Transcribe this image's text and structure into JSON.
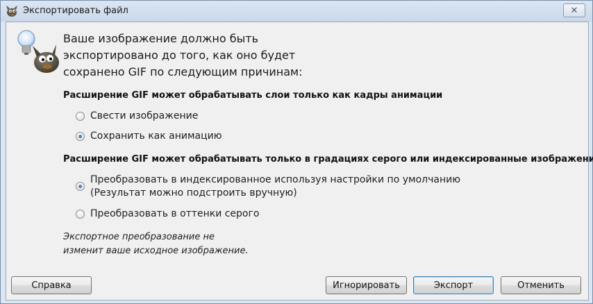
{
  "window": {
    "title": "Экспортировать файл",
    "close_glyph": "✕"
  },
  "icons": {
    "app": "gimp-wilber-icon",
    "hint": "wilber-lightbulb-icon"
  },
  "intro": {
    "line1": "Ваше изображение должно быть",
    "line2": "экспортировано до того, как оно будет",
    "line3": "сохранено GIF по следующим причинам:"
  },
  "section_layers": {
    "heading": "Расширение GIF может обрабатывать слои только как кадры анимации",
    "options": [
      {
        "label": "Свести изображение",
        "checked": false
      },
      {
        "label": "Сохранить как анимацию",
        "checked": true
      }
    ]
  },
  "section_color": {
    "heading": "Расширение GIF может обрабатывать только в градациях серого или индексированные изображения",
    "options": [
      {
        "line1": "Преобразовать в индексированное используя настройки по умолчанию",
        "line2": "(Результат можно подстроить вручную)",
        "checked": true
      },
      {
        "line1": "Преобразовать в оттенки серого",
        "checked": false
      }
    ]
  },
  "note": {
    "line1": "Экспортное преобразование не",
    "line2": "изменит ваше исходное изображение."
  },
  "buttons": {
    "help": "Справка",
    "ignore": "Игнорировать",
    "export": "Экспорт",
    "cancel": "Отменить"
  },
  "colors": {
    "accent": "#3c7fb1",
    "radio_selected": "#164f9c"
  }
}
